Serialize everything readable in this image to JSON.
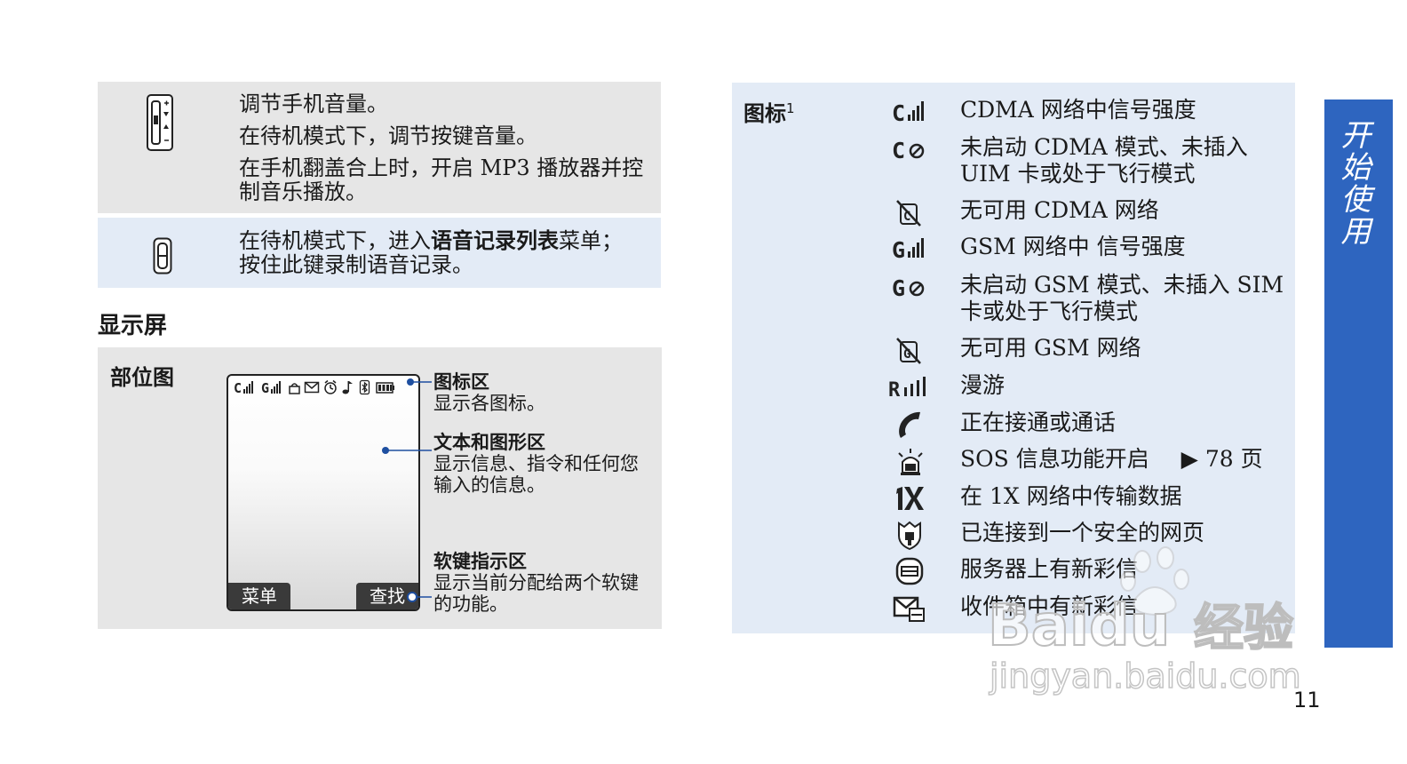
{
  "keys": {
    "volume": {
      "icon": "side-volume-key-icon",
      "lines": [
        "调节手机音量。",
        "在待机模式下，调节按键音量。",
        "在手机翻盖合上时，开启 MP3 播放器并控制音乐播放。"
      ]
    },
    "voice": {
      "icon": "voice-record-key-icon",
      "text_before": "在待机模式下，进入",
      "text_bold": "语音记录列表",
      "text_after": "菜单；",
      "text_line2": "按住此键录制语音记录。"
    }
  },
  "display_section": {
    "heading": "显示屏",
    "panel_label": "部位图",
    "softkey_left": "菜单",
    "softkey_right": "查找",
    "callouts": [
      {
        "title": "图标区",
        "desc": "显示各图标。"
      },
      {
        "title": "文本和图形区",
        "desc": "显示信息、指令和任何您输入的信息。"
      },
      {
        "title": "软键指示区",
        "desc": "显示当前分配给两个软键的功能。"
      }
    ]
  },
  "icons_section": {
    "label": "图标",
    "label_sup": "1",
    "rows": [
      {
        "icon": "cdma-signal-icon",
        "desc": "CDMA 网络中信号强度"
      },
      {
        "icon": "cdma-off-icon",
        "desc": "未启动 CDMA 模式、未插入 UIM 卡或处于飞行模式"
      },
      {
        "icon": "cdma-no-network-icon",
        "desc": "无可用 CDMA 网络"
      },
      {
        "icon": "gsm-signal-icon",
        "desc": "GSM 网络中 信号强度"
      },
      {
        "icon": "gsm-off-icon",
        "desc": "未启动 GSM 模式、未插入 SIM 卡或处于飞行模式"
      },
      {
        "icon": "gsm-no-network-icon",
        "desc": "无可用 GSM 网络"
      },
      {
        "icon": "roaming-icon",
        "desc": "漫游"
      },
      {
        "icon": "call-handset-icon",
        "desc": "正在接通或通话"
      },
      {
        "icon": "sos-alarm-icon",
        "desc": "SOS 信息功能开启",
        "ref": "▶ 78 页"
      },
      {
        "icon": "1x-data-icon",
        "desc": "在 1X 网络中传输数据"
      },
      {
        "icon": "secure-shield-icon",
        "desc": "已连接到一个安全的网页"
      },
      {
        "icon": "server-message-icon",
        "desc": "服务器上有新彩信"
      },
      {
        "icon": "inbox-message-icon",
        "desc": "收件箱中有新彩信"
      }
    ]
  },
  "side_tab": "开始使用",
  "page_number": "11",
  "watermark": {
    "brand": "Baidu",
    "brand_cn": "经验",
    "url": "jingyan.baidu.com"
  }
}
